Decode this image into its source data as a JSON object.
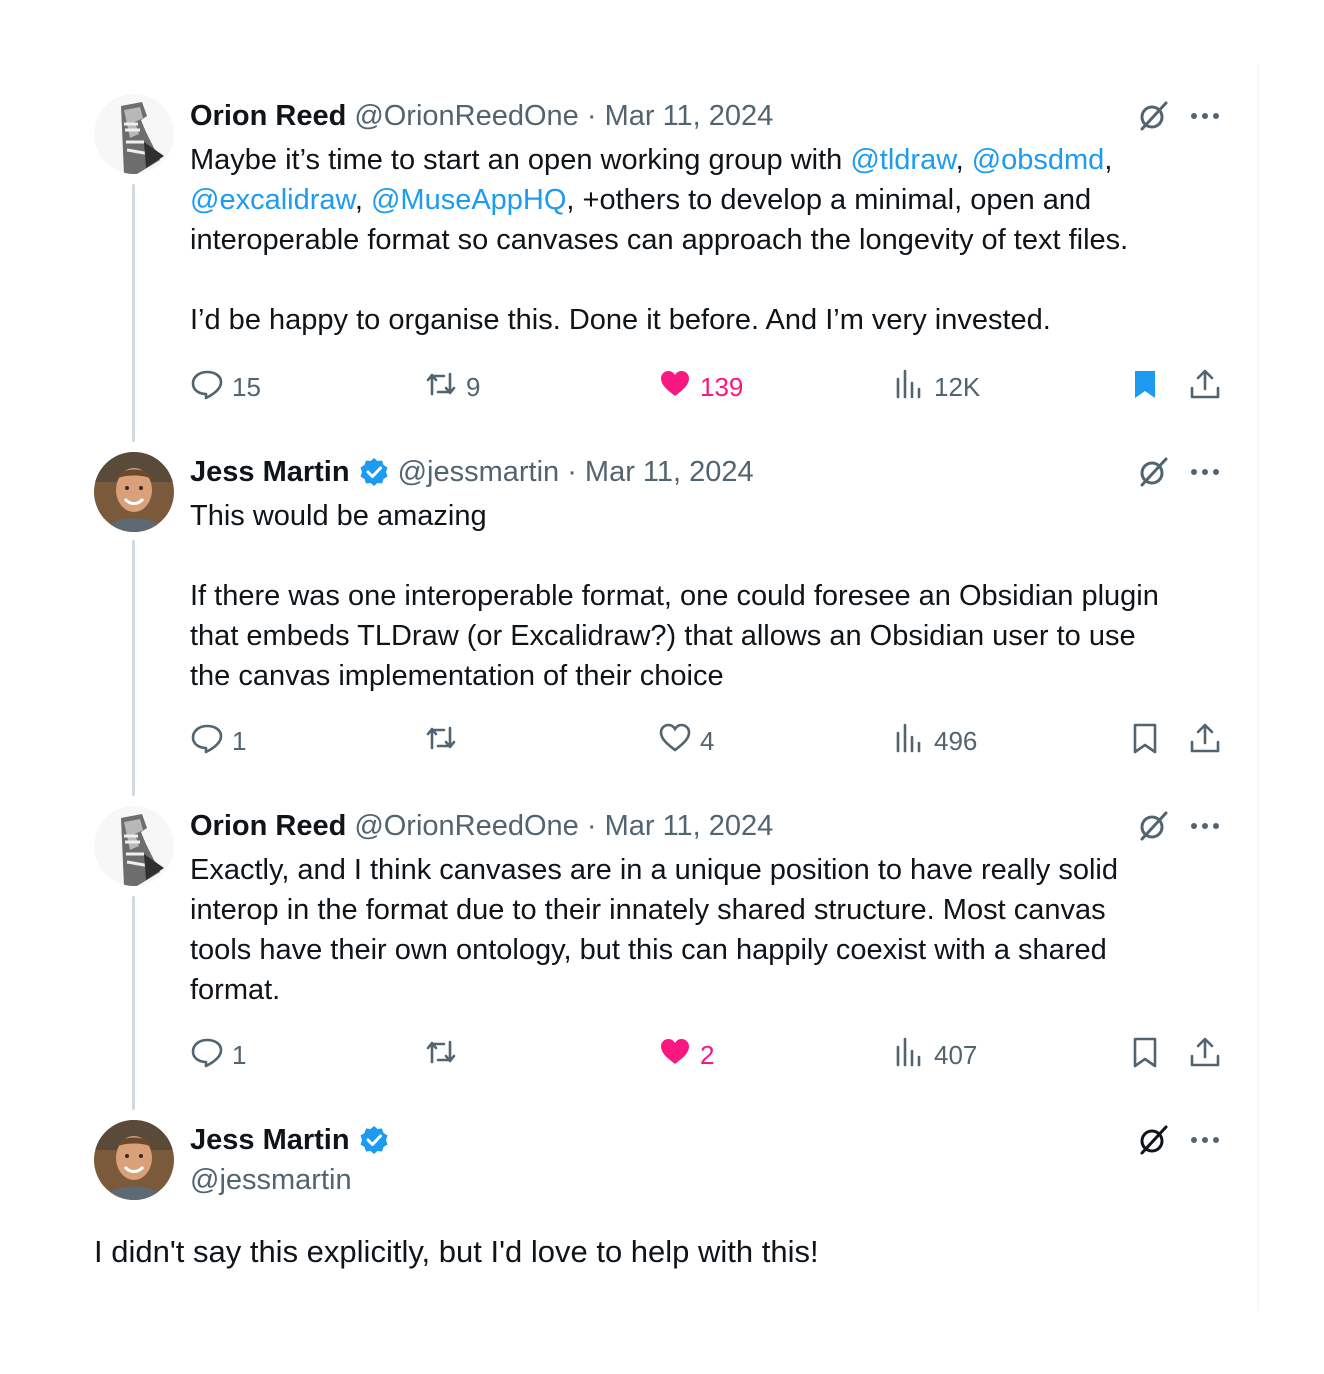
{
  "tweets": [
    {
      "name": "Orion Reed",
      "meta": "@OrionReedOne · Mar 11, 2024",
      "verified": false,
      "lines": [
        [
          [
            "Maybe it’s time to start an open working group with ",
            false
          ],
          [
            "@tldraw",
            true
          ],
          [
            ", ",
            false
          ],
          [
            "@obsdmd",
            true
          ],
          [
            ",",
            false
          ]
        ],
        [
          [
            "@excalidraw",
            true
          ],
          [
            ", ",
            false
          ],
          [
            "@MuseAppHQ",
            true
          ],
          [
            ", +others to develop a minimal, open and",
            false
          ]
        ],
        [
          [
            "interoperable format so canvases can approach the longevity of text files.",
            false
          ]
        ],
        [],
        [
          [
            "I’d be happy to organise this. Done it before. And I’m very invested.",
            false
          ]
        ]
      ],
      "stats": {
        "replies": "15",
        "reposts": "9",
        "likes": "139",
        "views": "12K"
      },
      "liked": true,
      "bookmarked": true
    },
    {
      "name": "Jess Martin",
      "meta": "@jessmartin · Mar 11, 2024",
      "verified": true,
      "lines": [
        [
          [
            "This would be amazing",
            false
          ]
        ],
        [],
        [
          [
            "If there was one interoperable format, one could foresee an Obsidian plugin",
            false
          ]
        ],
        [
          [
            "that embeds TLDraw (or Excalidraw?) that allows an Obsidian user to use",
            false
          ]
        ],
        [
          [
            "the canvas implementation of their choice",
            false
          ]
        ]
      ],
      "stats": {
        "replies": "1",
        "reposts": "",
        "likes": "4",
        "views": "496"
      },
      "liked": false,
      "bookmarked": false
    },
    {
      "name": "Orion Reed",
      "meta": "@OrionReedOne · Mar 11, 2024",
      "verified": false,
      "lines": [
        [
          [
            "Exactly, and I think canvases are in a unique position to have really solid",
            false
          ]
        ],
        [
          [
            "interop in the format due to their innately shared structure. Most canvas",
            false
          ]
        ],
        [
          [
            "tools have their own ontology, but this can happily coexist with a shared",
            false
          ]
        ],
        [
          [
            "format.",
            false
          ]
        ]
      ],
      "stats": {
        "replies": "1",
        "reposts": "",
        "likes": "2",
        "views": "407"
      },
      "liked": true,
      "bookmarked": false
    }
  ],
  "main_tweet": {
    "name": "Jess Martin",
    "handle": "@jessmartin",
    "verified": true,
    "text": "I didn't say this explicitly, but I'd love to help with this!"
  },
  "icons": {
    "reply": "reply-bubble-icon",
    "repost": "repost-arrows-icon",
    "like": "heart-icon",
    "views": "views-chart-icon",
    "bookmark": "bookmark-icon",
    "share": "share-upload-icon",
    "grok": "grok-slash-icon",
    "more": "more-dots-icon",
    "verified": "verified-badge-icon"
  },
  "colors": {
    "text": "#0f1419",
    "secondary": "#536471",
    "accent": "#1d9bf0",
    "like": "#f91880",
    "thread_line": "#cfd9de"
  }
}
